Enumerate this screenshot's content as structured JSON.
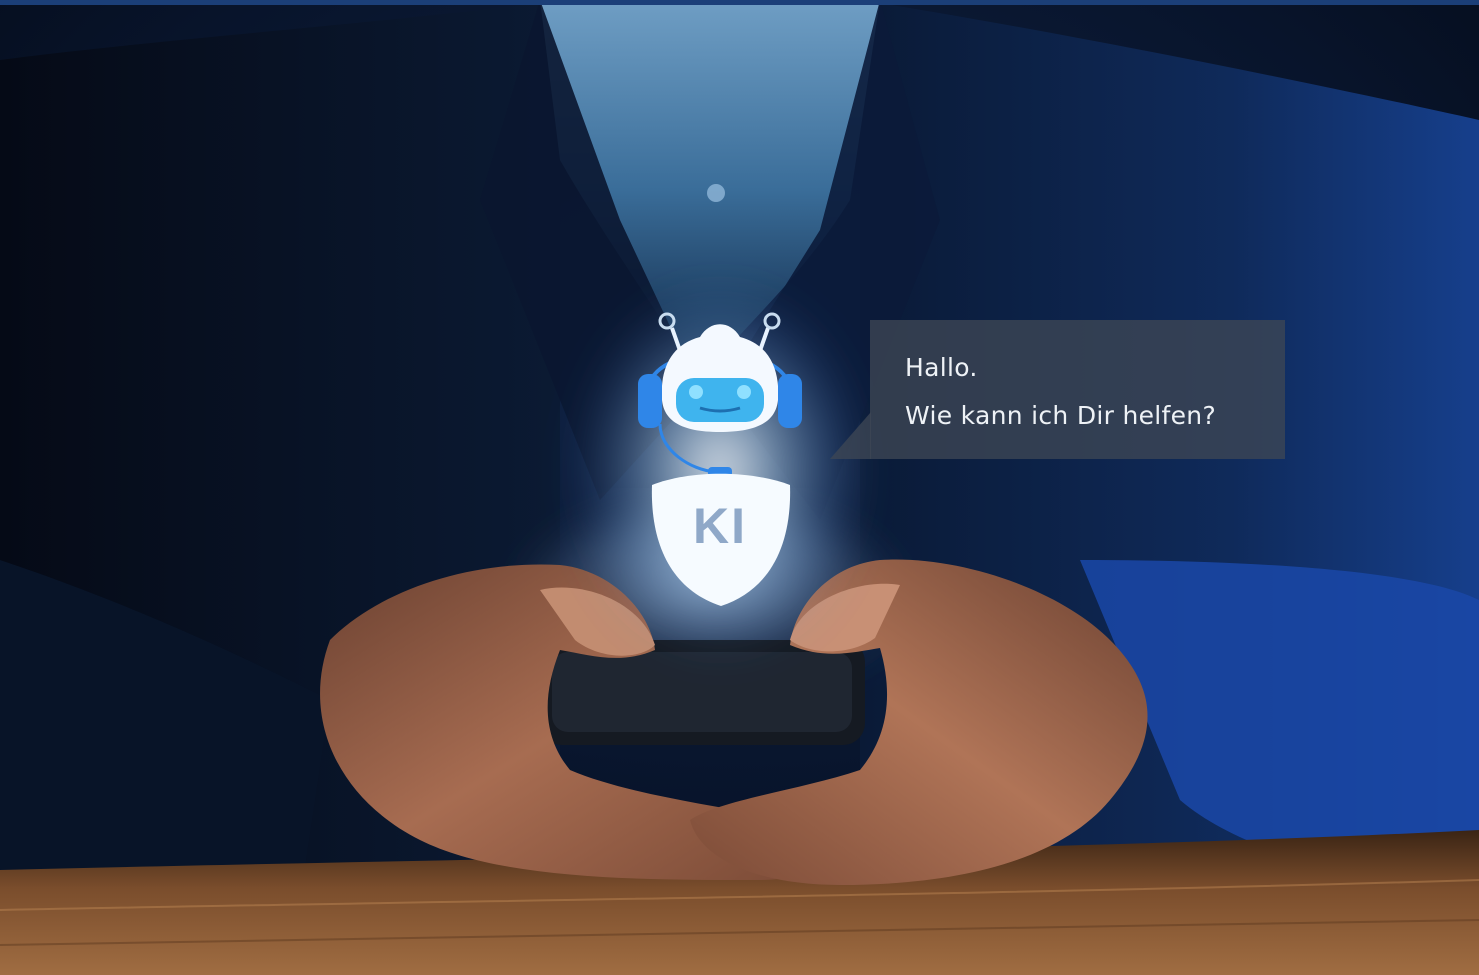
{
  "speech_bubble": {
    "line1": "Hallo.",
    "line2": "Wie kann ich Dir helfen?"
  },
  "chatbot": {
    "badge_text": "KI",
    "icon": "robot-chatbot-icon"
  },
  "colors": {
    "top_bar": "#1b3f78",
    "robot_accent": "#2f86e8",
    "robot_screen": "#3fb4ee",
    "bubble_bg": "#3e4654",
    "bubble_text": "#eef2f6",
    "table_wood": "#8a5a34"
  }
}
